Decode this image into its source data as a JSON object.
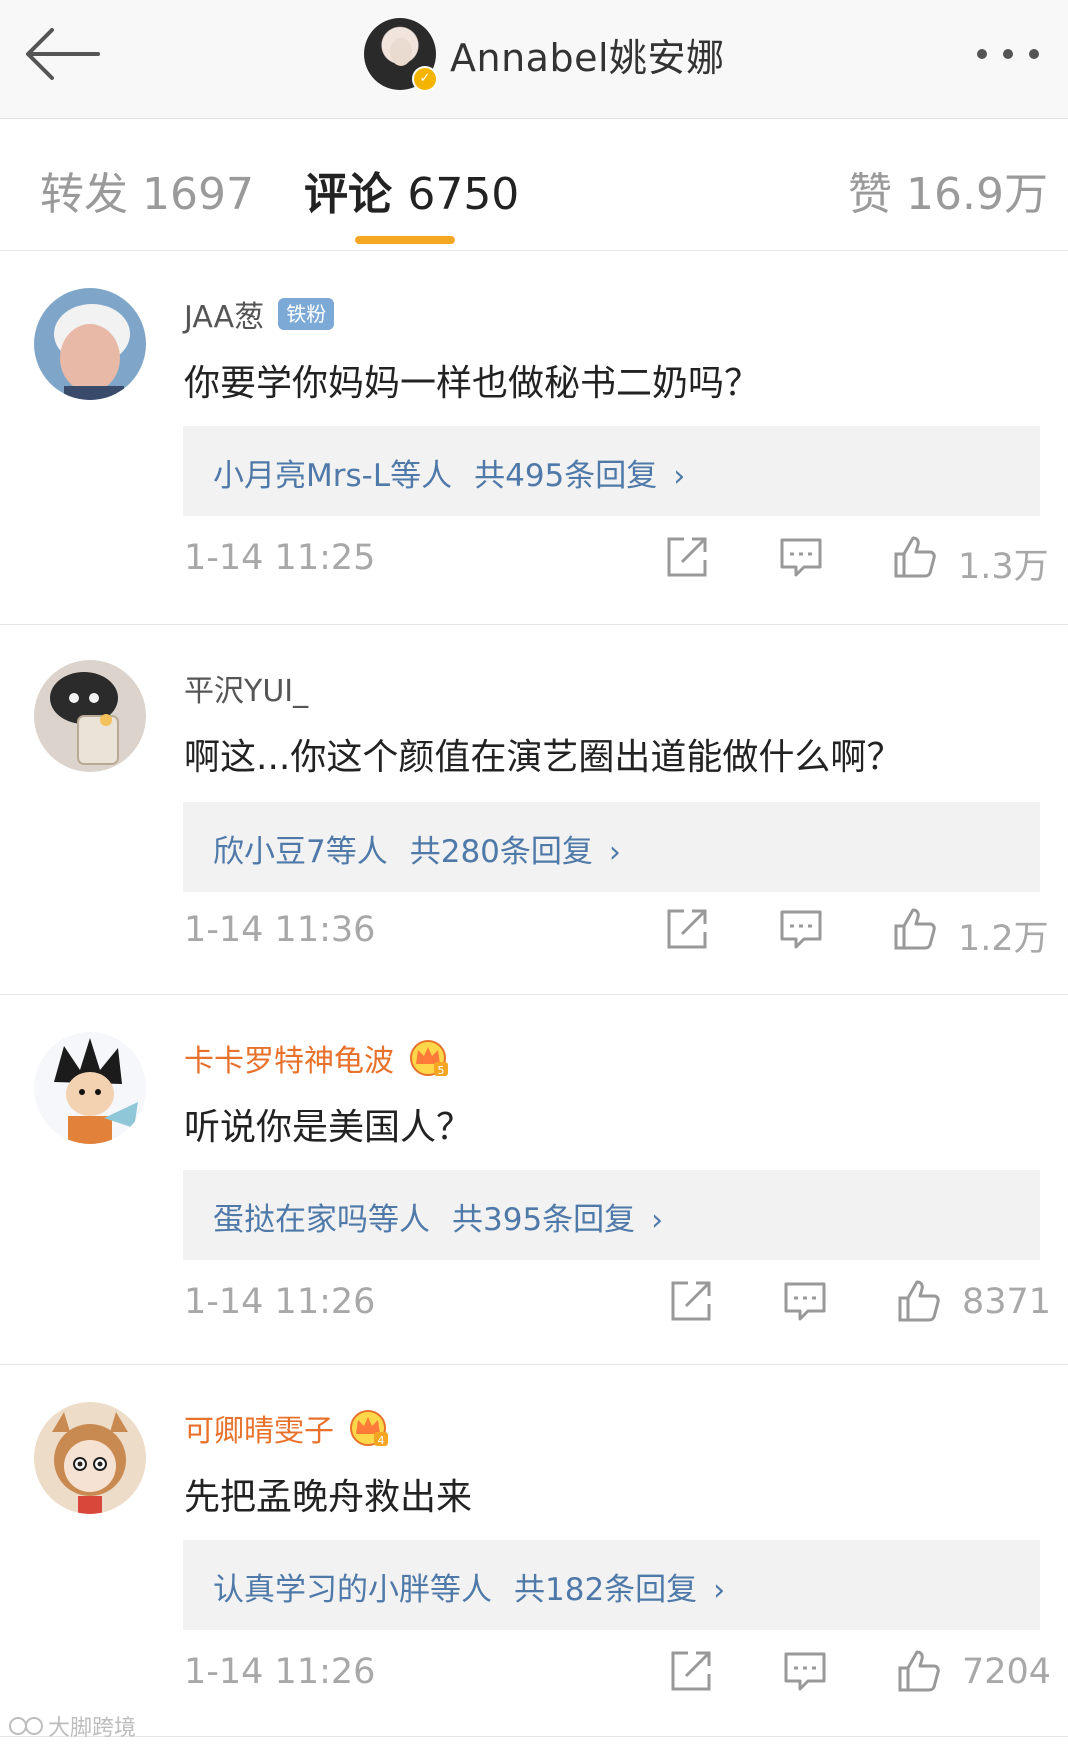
{
  "header": {
    "profile_name": "Annabel姚安娜",
    "back_icon": "back-arrow-icon",
    "more_icon": "more-dots-icon"
  },
  "tabs": [
    {
      "label": "转发",
      "count": "1697"
    },
    {
      "label": "评论",
      "count": "6750"
    },
    {
      "label": "赞",
      "count": "16.9万"
    }
  ],
  "comments": [
    {
      "user": "JAA葱",
      "badge": "铁粉",
      "text": "你要学你妈妈一样也做秘书二奶吗？",
      "reply_users": "小月亮Mrs-L等人",
      "reply_count": "共495条回复",
      "time": "1-14 11:25",
      "likes": "1.3万"
    },
    {
      "user": "平沢YUI_",
      "text": "啊这...你这个颜值在演艺圈出道能做什么啊？",
      "reply_users": "欣小豆7等人",
      "reply_count": "共280条回复",
      "time": "1-14 11:36",
      "likes": "1.2万"
    },
    {
      "user": "卡卡罗特神龟波",
      "crown_level": "5",
      "text": "听说你是美国人？",
      "reply_users": "蛋挞在家吗等人",
      "reply_count": "共395条回复",
      "time": "1-14 11:26",
      "likes": "8371"
    },
    {
      "user": "可卿晴雯子",
      "crown_level": "4",
      "text": "先把孟晚舟救出来",
      "reply_users": "认真学习的小胖等人",
      "reply_count": "共182条回复",
      "time": "1-14 11:26",
      "likes": "7204"
    }
  ],
  "watermark": "大脚跨境",
  "colors": {
    "accent": "#f5a623",
    "link": "#4f79a8",
    "vip_name": "#e8722c",
    "muted": "#a8a8a8"
  }
}
